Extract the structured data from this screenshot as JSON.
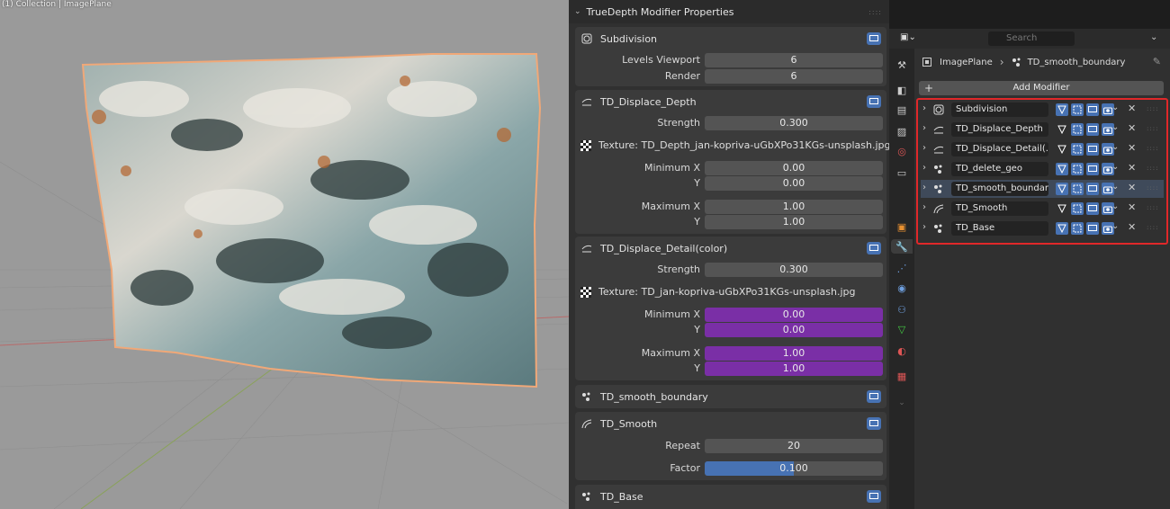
{
  "viewport": {
    "header_text": "(1) Collection | ImagePlane"
  },
  "popover": {
    "title": "TrueDepth Modifier Properties",
    "panels": {
      "subdivision": {
        "name": "Subdivision",
        "levels_viewport_label": "Levels Viewport",
        "levels_viewport_value": "6",
        "render_label": "Render",
        "render_value": "6"
      },
      "displace_depth": {
        "name": "TD_Displace_Depth",
        "strength_label": "Strength",
        "strength_value": "0.300",
        "texture_text": "Texture: TD_Depth_jan-kopriva-uGbXPo31KGs-unsplash.jpg",
        "min_x_label": "Minimum X",
        "min_x_value": "0.00",
        "min_y_label": "Y",
        "min_y_value": "0.00",
        "max_x_label": "Maximum X",
        "max_x_value": "1.00",
        "max_y_label": "Y",
        "max_y_value": "1.00"
      },
      "displace_detail": {
        "name": "TD_Displace_Detail(color)",
        "strength_label": "Strength",
        "strength_value": "0.300",
        "texture_text": "Texture: TD_jan-kopriva-uGbXPo31KGs-unsplash.jpg",
        "min_x_label": "Minimum X",
        "min_x_value": "0.00",
        "min_y_label": "Y",
        "min_y_value": "0.00",
        "max_x_label": "Maximum X",
        "max_x_value": "1.00",
        "max_y_label": "Y",
        "max_y_value": "1.00"
      },
      "smooth_boundary": {
        "name": "TD_smooth_boundary"
      },
      "smooth": {
        "name": "TD_Smooth",
        "repeat_label": "Repeat",
        "repeat_value": "20",
        "factor_label": "Factor",
        "factor_value": "0.100",
        "factor_fraction": 0.5
      },
      "base": {
        "name": "TD_Base"
      }
    }
  },
  "editor": {
    "search_placeholder": "Search",
    "breadcrumb": {
      "object": "ImagePlane",
      "modifier": "TD_smooth_boundary"
    },
    "add_modifier_label": "Add Modifier",
    "stack": [
      {
        "name": "Subdivision",
        "icon": "subdivision-icon"
      },
      {
        "name": "TD_Displace_Depth",
        "icon": "displace-icon"
      },
      {
        "name": "TD_Displace_Detail(...",
        "icon": "displace-icon"
      },
      {
        "name": "TD_delete_geo",
        "icon": "geometry-nodes-icon"
      },
      {
        "name": "TD_smooth_boundary",
        "icon": "geometry-nodes-icon"
      },
      {
        "name": "TD_Smooth",
        "icon": "smooth-icon"
      },
      {
        "name": "TD_Base",
        "icon": "geometry-nodes-icon"
      }
    ],
    "colors": {
      "highlight": "#e0282a",
      "toggle_on": "#4772b3",
      "purple_field": "#7a2fa6"
    }
  }
}
